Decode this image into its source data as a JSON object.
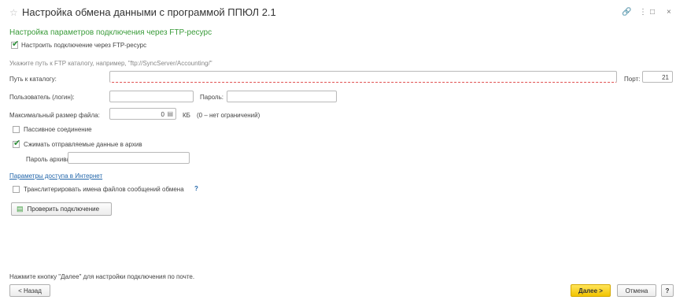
{
  "window": {
    "title": "Настройка обмена данными с программой ППЮЛ 2.1",
    "icons": [
      "link-icon",
      "more-icon",
      "maximize-icon",
      "close-icon"
    ]
  },
  "section_title": "Настройка параметров подключения через FTP-ресурс",
  "ftp_checkbox": {
    "label": "Настроить подключение через FTP-ресурс",
    "checked": true
  },
  "hint": "Укажите путь к FTP каталогу, например, \"ftp://SyncServer/Accounting/\"",
  "path": {
    "label": "Путь к каталогу:",
    "value": ""
  },
  "port": {
    "label": "Порт:",
    "value": "21"
  },
  "user": {
    "label": "Пользователь (логин):",
    "value": ""
  },
  "password": {
    "label": "Пароль:",
    "value": ""
  },
  "max_size": {
    "label": "Максимальный размер файла:",
    "value": "0",
    "unit": "КБ",
    "note": "(0 – нет ограничений)"
  },
  "passive": {
    "label": "Пассивное соединение",
    "checked": false
  },
  "compress": {
    "label": "Сжимать отправляемые данные в архив",
    "checked": true
  },
  "archive_password": {
    "label": "Пароль архива:",
    "value": ""
  },
  "internet_link": "Параметры доступа в Интернет",
  "transliterate": {
    "label": "Транслитерировать имена файлов сообщений обмена",
    "help": "?",
    "checked": false
  },
  "check_button": "Проверить подключение",
  "footer_hint": "Нажмите кнопку \"Далее\" для настройки подключения по почте.",
  "buttons": {
    "back": "< Назад",
    "next": "Далее >",
    "cancel": "Отмена",
    "help": "?"
  },
  "colors": {
    "accent_green": "#3a9b3a",
    "primary_button": "#f7cf1a",
    "link": "#2266aa"
  }
}
